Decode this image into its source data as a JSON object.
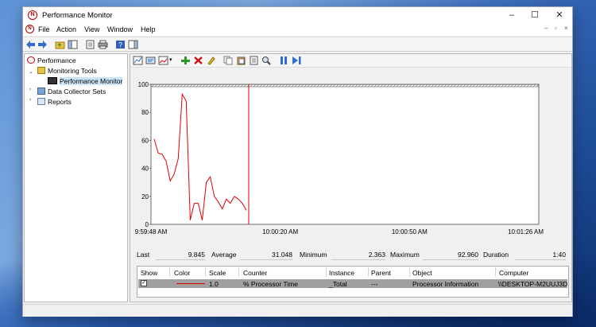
{
  "window": {
    "title": "Performance Monitor",
    "app_icon": "perfmon-icon"
  },
  "menu": [
    "File",
    "Action",
    "View",
    "Window",
    "Help"
  ],
  "mdi_controls": [
    "–",
    "▫",
    "×"
  ],
  "tree": {
    "items": [
      {
        "label": "Performance",
        "icon": "perfmon-icon"
      },
      {
        "label": "Monitoring Tools",
        "icon": "folder-icon"
      },
      {
        "label": "Performance Monitor",
        "icon": "monitor-icon"
      },
      {
        "label": "Data Collector Sets",
        "icon": "data-collector-icon"
      },
      {
        "label": "Reports",
        "icon": "reports-icon"
      }
    ]
  },
  "chart_data": {
    "type": "line",
    "title": "",
    "xlabel": "",
    "ylabel": "",
    "ylim": [
      0,
      100
    ],
    "yticks": [
      "100",
      "80",
      "60",
      "40",
      "20",
      "0"
    ],
    "xticks": [
      "9:59:48 AM",
      "10:00:20 AM",
      "10:00:50 AM",
      "10:01:26 AM"
    ],
    "grid": false,
    "series": [
      {
        "name": "% Processor Time",
        "color": "#e00000",
        "values": [
          61,
          51,
          50,
          45,
          31,
          36,
          47,
          93,
          88,
          3,
          15,
          15,
          3,
          30,
          34,
          20,
          16,
          11,
          18,
          15,
          20,
          18,
          15,
          10
        ]
      }
    ],
    "time_bar_color": "#e00000"
  },
  "stats": {
    "last_label": "Last",
    "last_value": "9.845",
    "average_label": "Average",
    "average_value": "31.048",
    "minimum_label": "Minimum",
    "minimum_value": "2.363",
    "maximum_label": "Maximum",
    "maximum_value": "92.960",
    "duration_label": "Duration",
    "duration_value": "1:40"
  },
  "counters": {
    "headers": [
      "Show",
      "Color",
      "Scale",
      "Counter",
      "Instance",
      "Parent",
      "Object",
      "Computer"
    ],
    "rows": [
      {
        "show": true,
        "color": "#e00000",
        "scale": "1.0",
        "counter": "% Processor Time",
        "instance": "_Total",
        "parent": "---",
        "object": "Processor Information",
        "computer": "\\\\DESKTOP-M2UUJ3D"
      }
    ]
  }
}
